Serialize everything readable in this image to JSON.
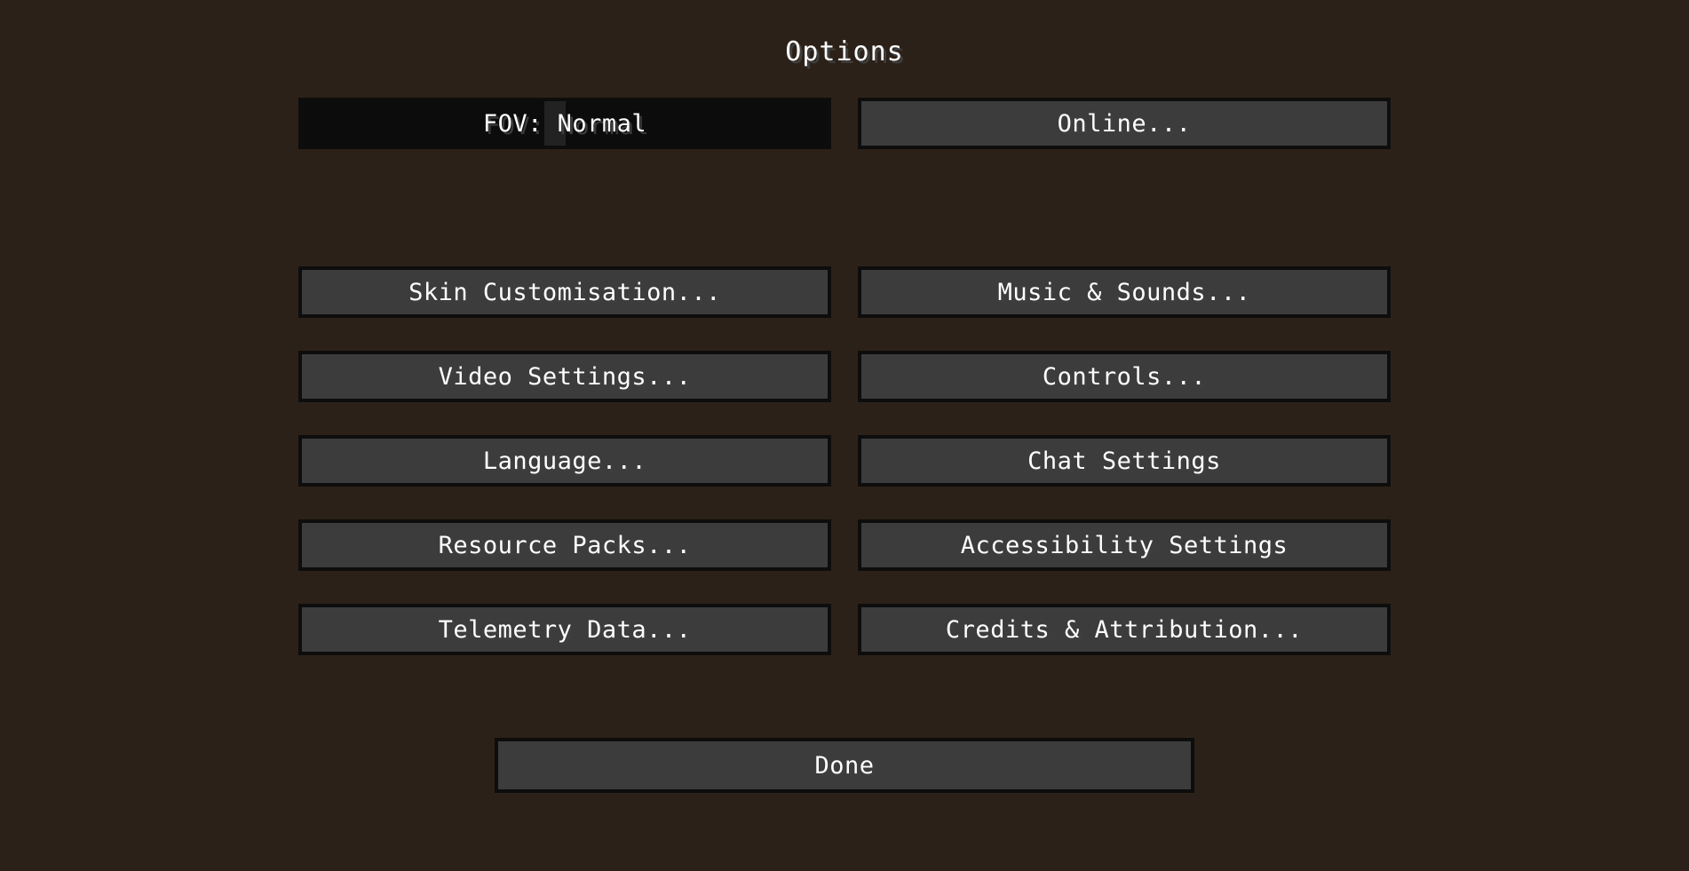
{
  "screen": {
    "title": "Options",
    "background_color": "#2c2118",
    "button_face_color": "#3c3c3c",
    "button_border_color": "#0d0d0d",
    "text_color": "#ffffff",
    "text_shadow_color": "#3e3e3e"
  },
  "slider": {
    "label": "FOV: Normal",
    "setting": "FOV",
    "value": "Normal",
    "handle_position_percent": 48,
    "track_color": "#0c0c0c",
    "handle_color": "#222222"
  },
  "top_row": {
    "online_label": "Online..."
  },
  "rows": [
    {
      "left": "Skin Customisation...",
      "right": "Music & Sounds..."
    },
    {
      "left": "Video Settings...",
      "right": "Controls..."
    },
    {
      "left": "Language...",
      "right": "Chat Settings"
    },
    {
      "left": "Resource Packs...",
      "right": "Accessibility Settings"
    },
    {
      "left": "Telemetry Data...",
      "right": "Credits & Attribution..."
    }
  ],
  "footer": {
    "done_label": "Done"
  }
}
